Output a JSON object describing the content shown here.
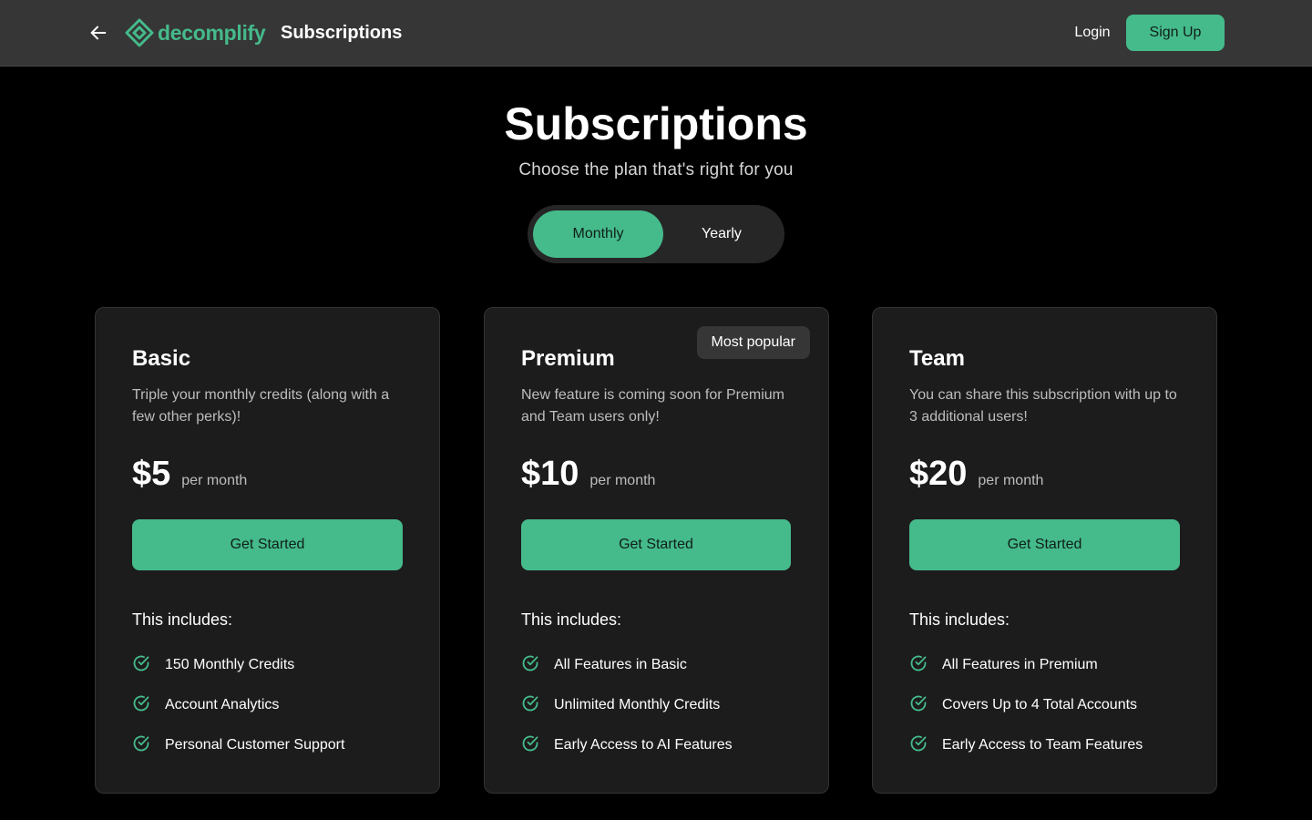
{
  "header": {
    "back_icon": "arrow-left-icon",
    "logo_icon": "diamond-logo-icon",
    "logo_text": "decomplify",
    "title": "Subscriptions",
    "login_label": "Login",
    "signup_label": "Sign Up"
  },
  "hero": {
    "title": "Subscriptions",
    "subtitle": "Choose the plan that's right for you"
  },
  "billing_toggle": {
    "monthly_label": "Monthly",
    "yearly_label": "Yearly",
    "selected": "Monthly"
  },
  "colors": {
    "accent": "#45ba8b",
    "header_bg": "#363636",
    "card_bg": "#1c1c1c",
    "page_bg": "#000000"
  },
  "plans": [
    {
      "name": "Basic",
      "description": "Triple your monthly credits (along with a few other perks)!",
      "price": "$5",
      "period": "per month",
      "cta": "Get Started",
      "includes_label": "This includes:",
      "features": [
        "150 Monthly Credits",
        "Account Analytics",
        "Personal Customer Support"
      ]
    },
    {
      "name": "Premium",
      "badge": "Most popular",
      "description": "New feature is coming soon for Premium and Team users only!",
      "price": "$10",
      "period": "per month",
      "cta": "Get Started",
      "includes_label": "This includes:",
      "features": [
        "All Features in Basic",
        "Unlimited Monthly Credits",
        "Early Access to AI Features"
      ]
    },
    {
      "name": "Team",
      "description": "You can share this subscription with up to 3 additional users!",
      "price": "$20",
      "period": "per month",
      "cta": "Get Started",
      "includes_label": "This includes:",
      "features": [
        "All Features in Premium",
        "Covers Up to 4 Total Accounts",
        "Early Access to Team Features"
      ]
    }
  ]
}
